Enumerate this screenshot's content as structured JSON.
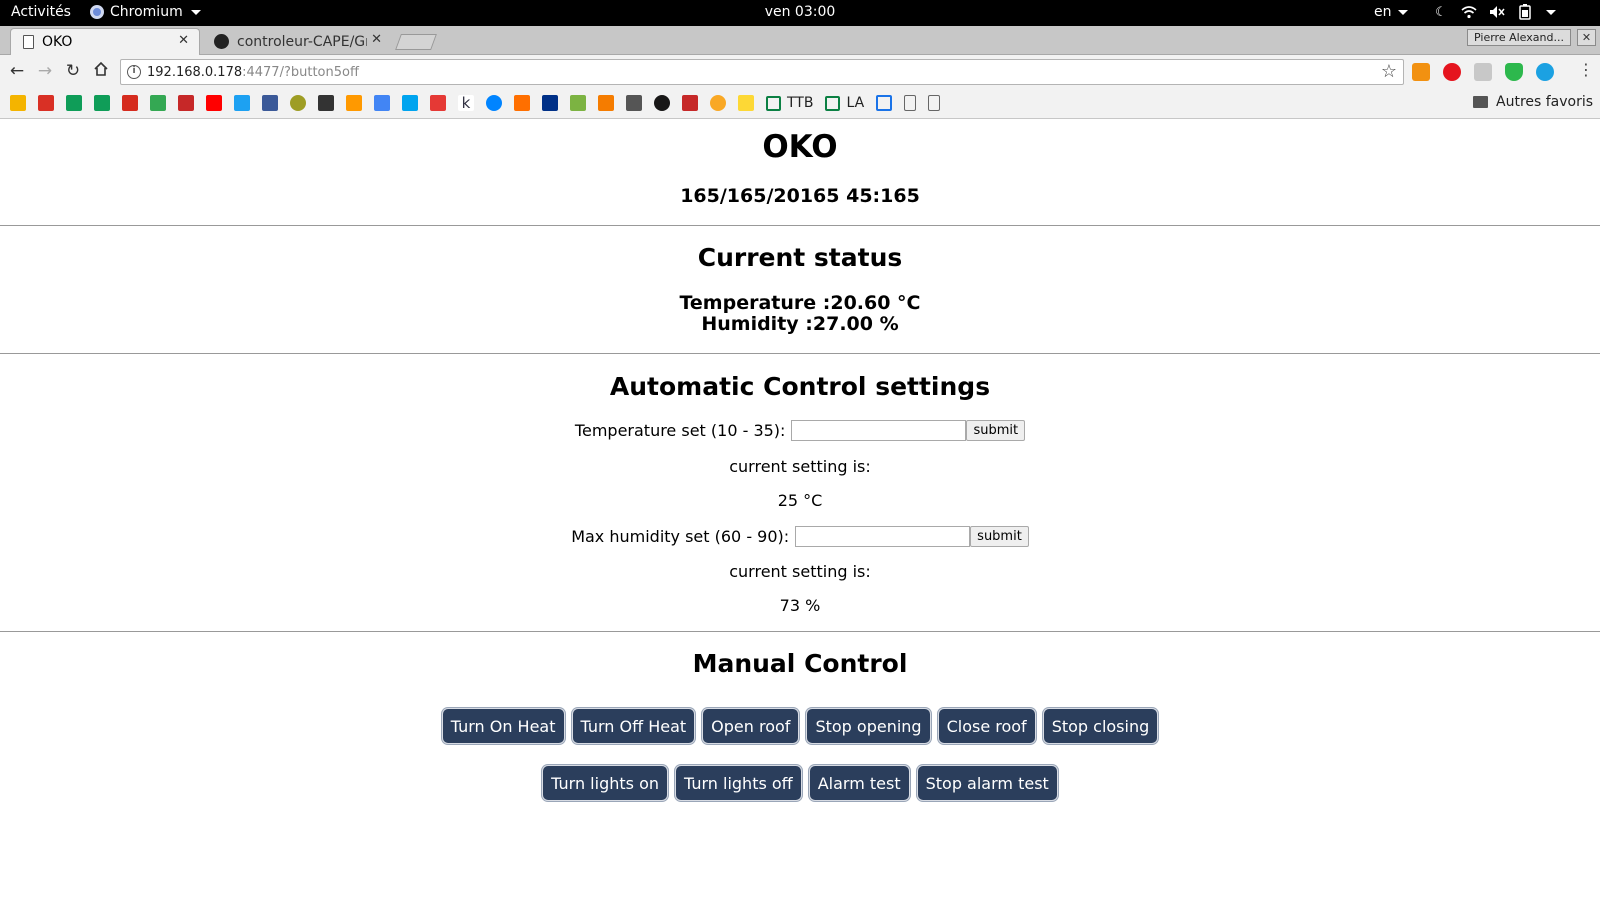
{
  "system": {
    "activities": "Activités",
    "app_name": "Chromium",
    "clock": "ven 03:00",
    "lang": "en"
  },
  "browser": {
    "tabs": [
      {
        "title": "OKO",
        "active": true
      },
      {
        "title": "controleur-CAPE/Gr",
        "active": false
      }
    ],
    "profile_name": "Pierre Alexand...",
    "url_host": "192.168.0.178",
    "url_rest": ":4477/?button5off",
    "bookmarks": {
      "text_items": [
        "TTB",
        "LA"
      ],
      "other": "Autres favoris"
    }
  },
  "page": {
    "title": "OKO",
    "datetime": "165/165/20165 45:165",
    "status": {
      "heading": "Current status",
      "temperature": "Temperature :20.60 °C",
      "humidity": "Humidity :27.00 %"
    },
    "auto": {
      "heading": "Automatic Control settings",
      "temp_label": "Temperature set (10 - 35):",
      "temp_value": "",
      "submit_label": "submit",
      "current_label": "current setting is:",
      "temp_current": "25 °C",
      "hum_label": "Max humidity set (60 - 90):",
      "hum_value": "",
      "hum_current": "73 %"
    },
    "manual": {
      "heading": "Manual Control",
      "row1": [
        "Turn On Heat",
        "Turn Off Heat",
        "Open roof",
        "Stop opening",
        "Close roof",
        "Stop closing"
      ],
      "row2": [
        "Turn lights on",
        "Turn lights off",
        "Alarm test",
        "Stop alarm test"
      ]
    }
  }
}
